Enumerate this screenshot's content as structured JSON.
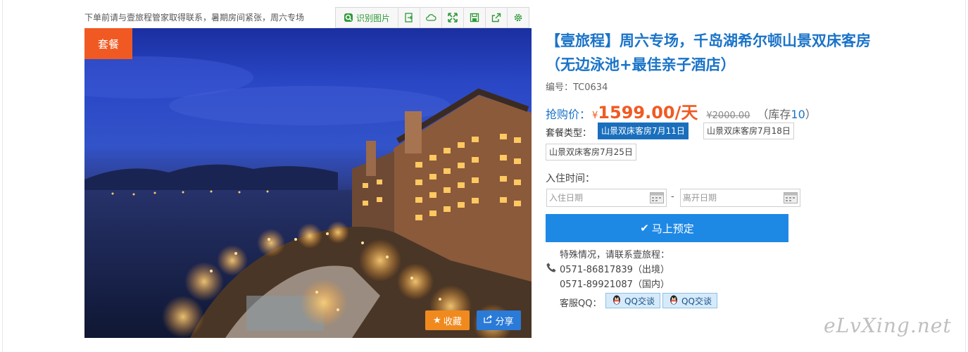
{
  "notice": "下单前请与壹旅程管家取得联系，暑期房间紧张，周六专场",
  "toolbar": {
    "ocr_label": "识别图片",
    "icons": [
      "export-icon",
      "cloud-icon",
      "expand-icon",
      "save-icon",
      "share-out-icon",
      "settings-icon"
    ]
  },
  "photo": {
    "badge": "套餐",
    "favorite_label": "收藏",
    "share_label": "分享"
  },
  "product": {
    "title": "【壹旅程】周六专场，千岛湖希尔顿山景双床客房（无边泳池+最佳亲子酒店）",
    "code": "编号：TC0634",
    "price_label": "抢购价：",
    "currency": "¥",
    "price": "1599.00/天",
    "original_price": "¥2000.00",
    "stock_prefix": "（库存",
    "stock": "10",
    "stock_suffix": "）"
  },
  "packages": {
    "label": "套餐类型：",
    "options": [
      "山景双床客房7月11日",
      "山景双床客房7月18日",
      "山景双床客房7月25日"
    ],
    "selected": 0
  },
  "booking": {
    "checkin_label": "入住时间：",
    "checkin_placeholder": "入住日期",
    "checkout_placeholder": "离开日期",
    "separator": "-",
    "book_label": "马上预定"
  },
  "contact": {
    "intro": "特殊情况，请联系壹旅程：",
    "phone1": "0571-86817839（出境）",
    "phone2": "0571-89921087（国内）",
    "qq_label": "客服QQ：",
    "qq_buttons": [
      "QQ交谈",
      "QQ交谈"
    ]
  },
  "watermark": "eLvXing.net",
  "colors": {
    "accent_blue": "#1a73c8",
    "price_orange": "#f05a22",
    "book_button": "#1e88e5",
    "selected_package": "#1a6fbd",
    "toolbar_green": "#2f9a3a"
  }
}
